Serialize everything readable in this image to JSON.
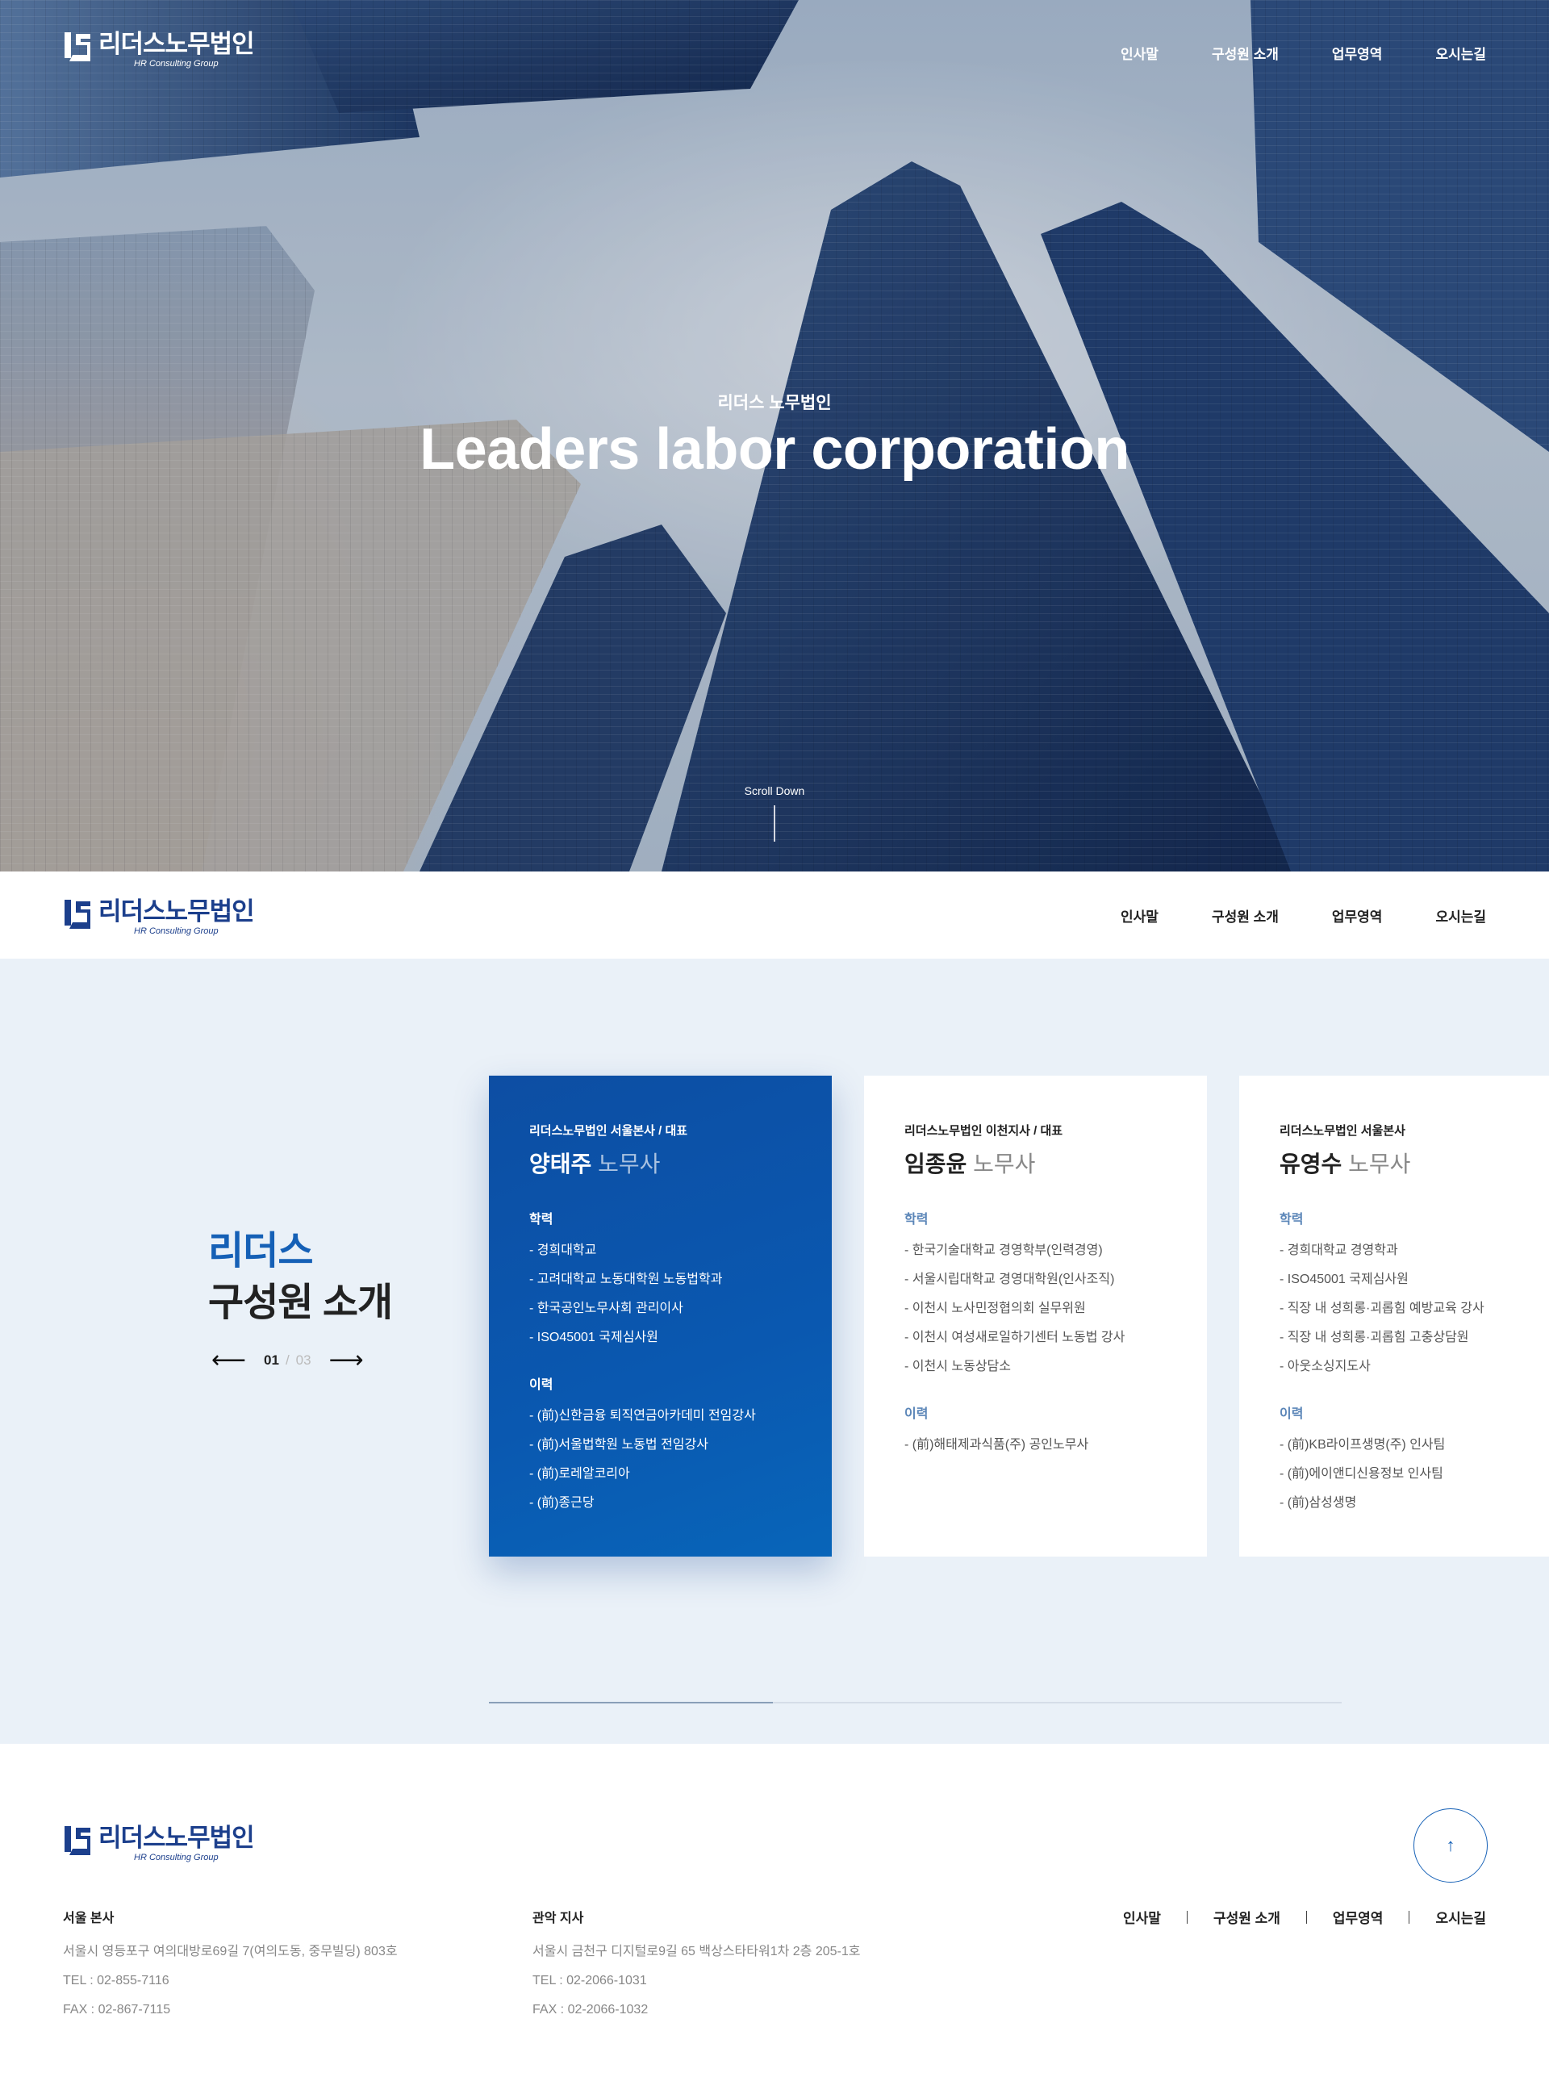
{
  "brand": {
    "name": "리더스노무법인",
    "sub": "HR Consulting Group"
  },
  "nav": [
    "인사말",
    "구성원 소개",
    "업무영역",
    "오시는길"
  ],
  "hero": {
    "subtitle": "리더스 노무법인",
    "title": "Leaders labor corporation",
    "scroll": "Scroll Down"
  },
  "members_section": {
    "title_line1": "리더스",
    "title_line2": "구성원 소개",
    "pager": {
      "current": "01",
      "separator": "/",
      "total": "03"
    },
    "progress": 0.333,
    "cards": [
      {
        "org": "리더스노무법인 서울본사 / 대표",
        "name": "양태주",
        "title": "노무사",
        "education_label": "학력",
        "education": [
          "- 경희대학교",
          "- 고려대학교 노동대학원 노동법학과",
          "- 한국공인노무사회 관리이사",
          "- ISO45001 국제심사원"
        ],
        "career_label": "이력",
        "career": [
          "- (前)신한금융 퇴직연금아카데미 전임강사",
          "- (前)서울법학원 노동법 전임강사",
          "- (前)로레알코리아",
          "- (前)종근당"
        ]
      },
      {
        "org": "리더스노무법인 이천지사 / 대표",
        "name": "임종윤",
        "title": "노무사",
        "education_label": "학력",
        "education": [
          "- 한국기술대학교 경영학부(인력경영)",
          "- 서울시립대학교 경영대학원(인사조직)",
          "- 이천시 노사민정협의회 실무위원",
          "- 이천시 여성새로일하기센터 노동법 강사",
          "- 이천시 노동상담소"
        ],
        "career_label": "이력",
        "career": [
          "- (前)해태제과식품(주) 공인노무사"
        ]
      },
      {
        "org": "리더스노무법인 서울본사",
        "name": "유영수",
        "title": "노무사",
        "education_label": "학력",
        "education": [
          "- 경희대학교 경영학과",
          "- ISO45001 국제심사원",
          "- 직장 내 성희롱·괴롭힘 예방교육 강사",
          "- 직장 내 성희롱·괴롭힘 고충상담원",
          "- 아웃소싱지도사"
        ],
        "career_label": "이력",
        "career": [
          "- (前)KB라이프생명(주) 인사팀",
          "- (前)에이앤디신용정보 인사팀",
          "- (前)삼성생명"
        ]
      }
    ]
  },
  "footer": {
    "hq": {
      "label": "서울 본사",
      "address": "서울시 영등포구 여의대방로69길 7(여의도동, 중무빌딩) 803호",
      "tel": "TEL : 02-855-7116",
      "fax": "FAX : 02-867-7115"
    },
    "branch": {
      "label": "관악 지사",
      "address": "서울시 금천구 디지털로9길 65 백상스타타워1차 2층 205-1호",
      "tel": "TEL : 02-2066-1031",
      "fax": "FAX : 02-2066-1032"
    },
    "top_icon": "arrow-up-icon"
  }
}
